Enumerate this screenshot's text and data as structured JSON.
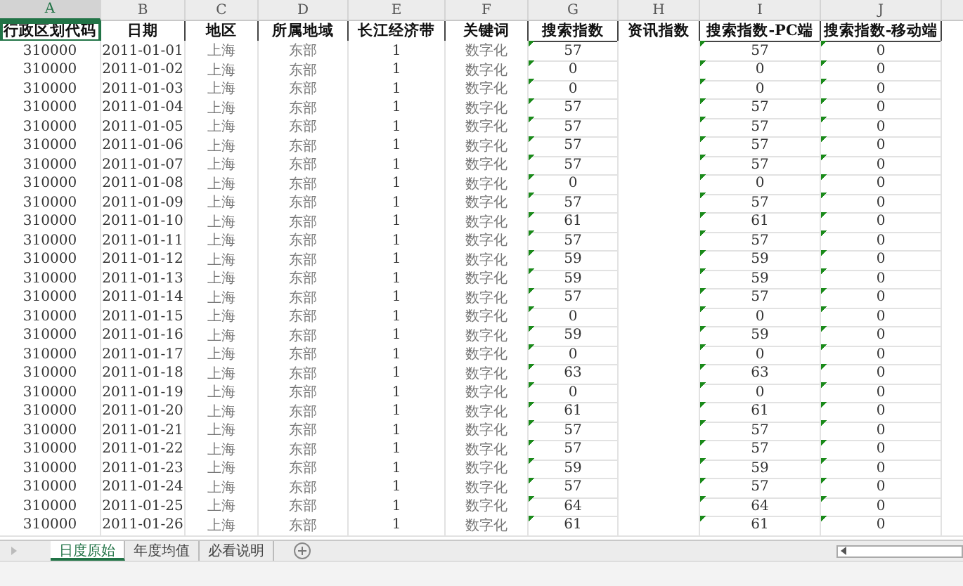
{
  "columns": [
    {
      "letter": "A",
      "header": "行政区划代码",
      "selected": true,
      "flagged": false
    },
    {
      "letter": "B",
      "header": "日期",
      "selected": false,
      "flagged": false
    },
    {
      "letter": "C",
      "header": "地区",
      "selected": false,
      "flagged": false
    },
    {
      "letter": "D",
      "header": "所属地域",
      "selected": false,
      "flagged": false
    },
    {
      "letter": "E",
      "header": "长江经济带",
      "selected": false,
      "flagged": false
    },
    {
      "letter": "F",
      "header": "关键词",
      "selected": false,
      "flagged": false
    },
    {
      "letter": "G",
      "header": "搜索指数",
      "selected": false,
      "flagged": true
    },
    {
      "letter": "H",
      "header": "资讯指数",
      "selected": false,
      "flagged": false
    },
    {
      "letter": "I",
      "header": "搜索指数-PC端",
      "selected": false,
      "flagged": true
    },
    {
      "letter": "J",
      "header": "搜索指数-移动端",
      "selected": false,
      "flagged": true
    }
  ],
  "rows": [
    [
      "310000",
      "2011-01-01",
      "上海",
      "东部",
      "1",
      "数字化",
      "57",
      null,
      "57",
      "0"
    ],
    [
      "310000",
      "2011-01-02",
      "上海",
      "东部",
      "1",
      "数字化",
      "0",
      null,
      "0",
      "0"
    ],
    [
      "310000",
      "2011-01-03",
      "上海",
      "东部",
      "1",
      "数字化",
      "0",
      null,
      "0",
      "0"
    ],
    [
      "310000",
      "2011-01-04",
      "上海",
      "东部",
      "1",
      "数字化",
      "57",
      null,
      "57",
      "0"
    ],
    [
      "310000",
      "2011-01-05",
      "上海",
      "东部",
      "1",
      "数字化",
      "57",
      null,
      "57",
      "0"
    ],
    [
      "310000",
      "2011-01-06",
      "上海",
      "东部",
      "1",
      "数字化",
      "57",
      null,
      "57",
      "0"
    ],
    [
      "310000",
      "2011-01-07",
      "上海",
      "东部",
      "1",
      "数字化",
      "57",
      null,
      "57",
      "0"
    ],
    [
      "310000",
      "2011-01-08",
      "上海",
      "东部",
      "1",
      "数字化",
      "0",
      null,
      "0",
      "0"
    ],
    [
      "310000",
      "2011-01-09",
      "上海",
      "东部",
      "1",
      "数字化",
      "57",
      null,
      "57",
      "0"
    ],
    [
      "310000",
      "2011-01-10",
      "上海",
      "东部",
      "1",
      "数字化",
      "61",
      null,
      "61",
      "0"
    ],
    [
      "310000",
      "2011-01-11",
      "上海",
      "东部",
      "1",
      "数字化",
      "57",
      null,
      "57",
      "0"
    ],
    [
      "310000",
      "2011-01-12",
      "上海",
      "东部",
      "1",
      "数字化",
      "59",
      null,
      "59",
      "0"
    ],
    [
      "310000",
      "2011-01-13",
      "上海",
      "东部",
      "1",
      "数字化",
      "59",
      null,
      "59",
      "0"
    ],
    [
      "310000",
      "2011-01-14",
      "上海",
      "东部",
      "1",
      "数字化",
      "57",
      null,
      "57",
      "0"
    ],
    [
      "310000",
      "2011-01-15",
      "上海",
      "东部",
      "1",
      "数字化",
      "0",
      null,
      "0",
      "0"
    ],
    [
      "310000",
      "2011-01-16",
      "上海",
      "东部",
      "1",
      "数字化",
      "59",
      null,
      "59",
      "0"
    ],
    [
      "310000",
      "2011-01-17",
      "上海",
      "东部",
      "1",
      "数字化",
      "0",
      null,
      "0",
      "0"
    ],
    [
      "310000",
      "2011-01-18",
      "上海",
      "东部",
      "1",
      "数字化",
      "63",
      null,
      "63",
      "0"
    ],
    [
      "310000",
      "2011-01-19",
      "上海",
      "东部",
      "1",
      "数字化",
      "0",
      null,
      "0",
      "0"
    ],
    [
      "310000",
      "2011-01-20",
      "上海",
      "东部",
      "1",
      "数字化",
      "61",
      null,
      "61",
      "0"
    ],
    [
      "310000",
      "2011-01-21",
      "上海",
      "东部",
      "1",
      "数字化",
      "57",
      null,
      "57",
      "0"
    ],
    [
      "310000",
      "2011-01-22",
      "上海",
      "东部",
      "1",
      "数字化",
      "57",
      null,
      "57",
      "0"
    ],
    [
      "310000",
      "2011-01-23",
      "上海",
      "东部",
      "1",
      "数字化",
      "59",
      null,
      "59",
      "0"
    ],
    [
      "310000",
      "2011-01-24",
      "上海",
      "东部",
      "1",
      "数字化",
      "57",
      null,
      "57",
      "0"
    ],
    [
      "310000",
      "2011-01-25",
      "上海",
      "东部",
      "1",
      "数字化",
      "64",
      null,
      "64",
      "0"
    ],
    [
      "310000",
      "2011-01-26",
      "上海",
      "东部",
      "1",
      "数字化",
      "61",
      null,
      "61",
      "0"
    ]
  ],
  "sheet_tabs": [
    {
      "label": "日度原始",
      "selected": true
    },
    {
      "label": "年度均值",
      "selected": false
    },
    {
      "label": "必看说明",
      "selected": false
    }
  ]
}
